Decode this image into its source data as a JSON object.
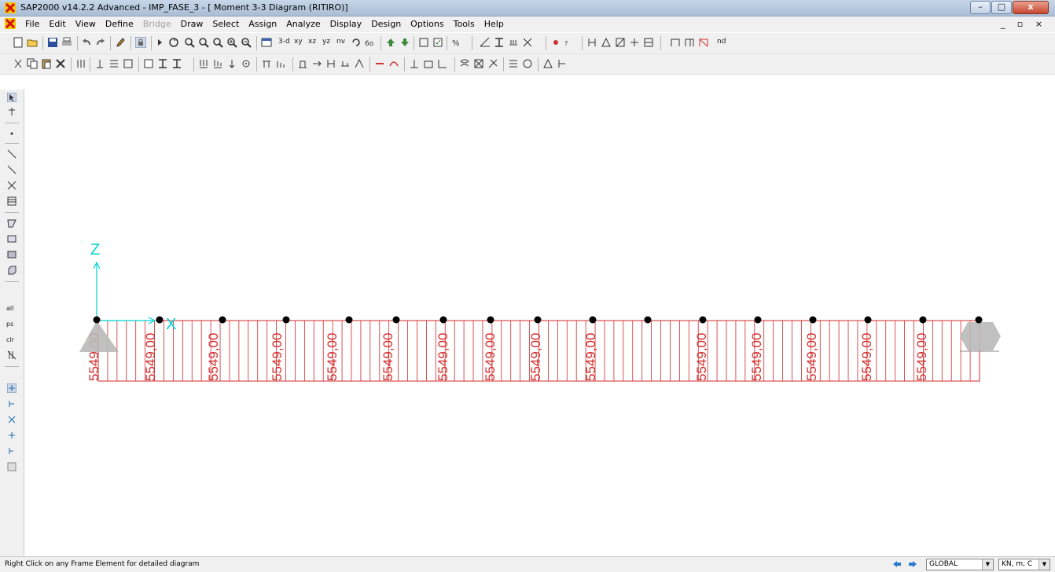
{
  "window": {
    "title": "SAP2000 v14.2.2 Advanced  - IMP_FASE_3 - [ Moment 3-3 Diagram  (RITIRO)]",
    "minimize_label": "–",
    "maximize_label": "□",
    "close_label": "x",
    "doc_controls": "_ ▫ ×"
  },
  "menus": [
    "File",
    "Edit",
    "View",
    "Define",
    "Bridge",
    "Draw",
    "Select",
    "Assign",
    "Analyze",
    "Display",
    "Design",
    "Options",
    "Tools",
    "Help"
  ],
  "toolbar_text": {
    "view_3d": "3-d",
    "view_xy": "xy",
    "view_xz": "xz",
    "view_yz": "yz",
    "view_nv": "nv",
    "nd": "nd"
  },
  "left_toolbar_text": {
    "all": "all",
    "ps": "ps",
    "clr": "clr"
  },
  "colors": {
    "diagram": "#d42a2a",
    "axes": "#00d2d2",
    "joint": "#000000",
    "support": "#b9b9b9"
  },
  "diagram": {
    "axis_z": "Z",
    "axis_x": "X",
    "moment_label": "5549,00",
    "moment_value": 5549.0,
    "joint_count": 17,
    "label_count": 15,
    "stripe_count": 94
  },
  "status": {
    "message": "Right Click on any Frame Element for detailed diagram",
    "coord_system": "GLOBAL",
    "units": "KN, m, C"
  }
}
